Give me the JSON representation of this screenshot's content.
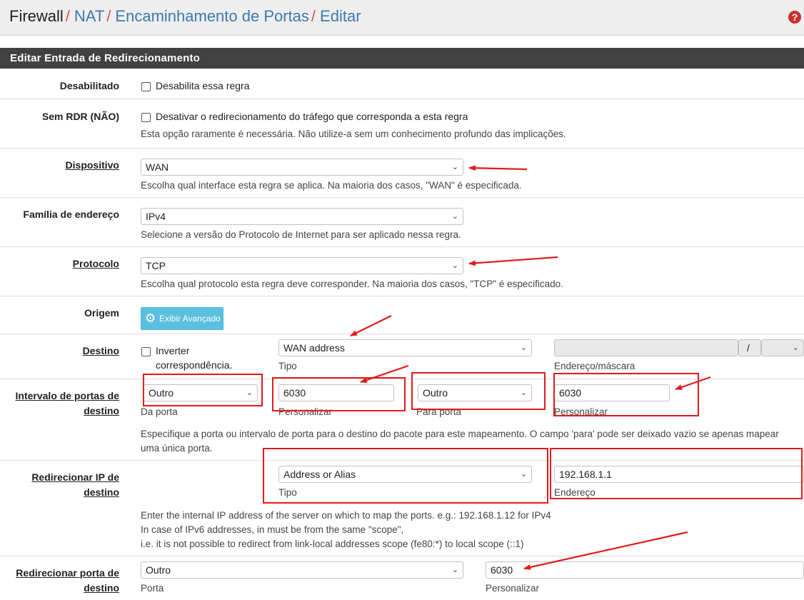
{
  "breadcrumb": {
    "items": [
      "Firewall",
      "NAT",
      "Encaminhamento de Portas",
      "Editar"
    ],
    "separator": "/"
  },
  "help_icon_symbol": "?",
  "panel_title": "Editar Entrada de Redirecionamento",
  "rows": {
    "disabled": {
      "label": "Desabilitado",
      "checkbox_label": "Desabilita essa regra"
    },
    "no_rdr": {
      "label": "Sem RDR (NÃO)",
      "checkbox_label": "Desativar o redirecionamento do tráfego que corresponda a esta regra",
      "help": "Esta opção raramente é necessária. Não utilize-a sem um conhecimento profundo das implicações."
    },
    "interface": {
      "label": "Dispositivo",
      "value": "WAN",
      "help": "Escolha qual interface esta regra se aplica. Na maioria dos casos, \"WAN\" é especificada."
    },
    "family": {
      "label": "Família de endereço",
      "value": "IPv4",
      "help": "Selecione a versão do Protocolo de Internet para ser aplicado nessa regra."
    },
    "protocol": {
      "label": "Protocolo",
      "value": "TCP",
      "help": "Escolha qual protocolo esta regra deve corresponder. Na maioria dos casos, \"TCP\" é especificado."
    },
    "source": {
      "label": "Origem",
      "button": "Exibir Avançado"
    },
    "destination": {
      "label": "Destino",
      "invert_line1": "Inverter",
      "invert_line2": "correspondência.",
      "type_value": "WAN address",
      "type_caption": "Tipo",
      "address_value": "",
      "slash": "/",
      "address_caption": "Endereço/máscara"
    },
    "dest_port": {
      "label_line1": "Intervalo de portas de",
      "label_line2": "destino",
      "from_value": "Outro",
      "from_caption": "Da porta",
      "from_custom": "6030",
      "from_custom_caption": "Personalizar",
      "to_value": "Outro",
      "to_caption": "Para porta",
      "to_custom": "6030",
      "to_custom_caption": "Personalizar",
      "help_line1": "Especifique a porta ou intervalo de porta para o destino do pacote para este mapeamento. O campo 'para' pode ser deixado vazio se apenas mapear",
      "help_line2": "uma única porta."
    },
    "redirect_ip": {
      "label_line1": "Redirecionar IP de",
      "label_line2": "destino",
      "type_value": "Address or Alias",
      "type_caption": "Tipo",
      "address_value": "192.168.1.1",
      "address_caption": "Endereço",
      "help_line1": "Enter the internal IP address of the server on which to map the ports. e.g.: 192.168.1.12 for IPv4",
      "help_line2": "In case of IPv6 addresses, in must be from the same \"scope\",",
      "help_line3": "i.e. it is not possible to redirect from link-local addresses scope (fe80:*) to local scope (::1)"
    },
    "redirect_port": {
      "label_line1": "Redirecionar porta de",
      "label_line2": "destino",
      "port_value": "Outro",
      "port_caption": "Porta",
      "custom_value": "6030",
      "custom_caption": "Personalizar"
    }
  },
  "annotation_color": "#e41a1a",
  "accent_link_color": "#3b79b0",
  "separator_color": "#d9534f",
  "button_color": "#5bc0de"
}
